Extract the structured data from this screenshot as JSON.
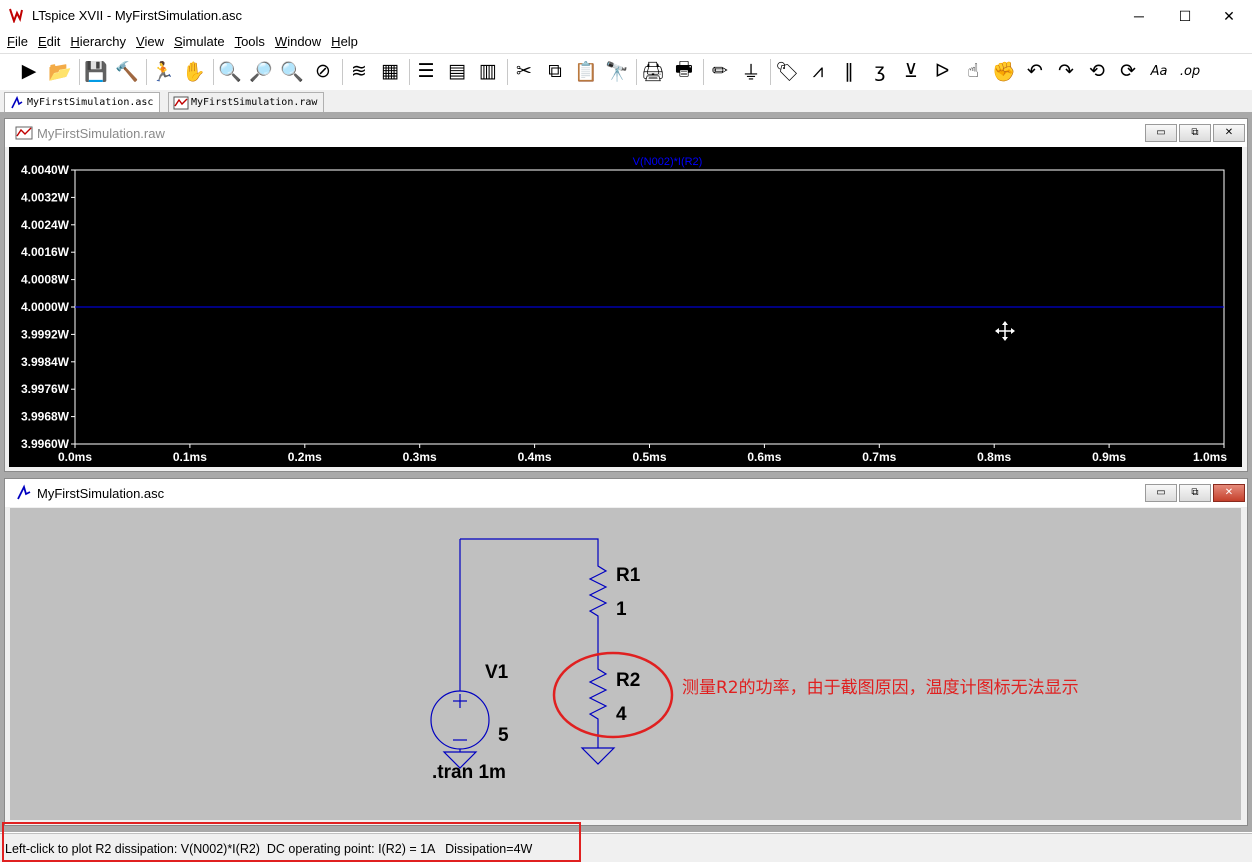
{
  "app": {
    "window_title": "LTspice XVII - MyFirstSimulation.asc",
    "controls": {
      "minimize": "─",
      "maximize": "☐",
      "close": "✕"
    }
  },
  "menu": [
    "File",
    "Edit",
    "Hierarchy",
    "View",
    "Simulate",
    "Tools",
    "Window",
    "Help"
  ],
  "menu_access_keys": [
    "F",
    "E",
    "H",
    "V",
    "S",
    "T",
    "W",
    "H"
  ],
  "toolbar": [
    {
      "name": "run-icon",
      "glyph": "▶"
    },
    {
      "name": "open-folder-icon",
      "glyph": "📂"
    },
    {
      "name": "save-icon",
      "glyph": "💾"
    },
    {
      "name": "control-panel-icon",
      "glyph": "🔨"
    },
    {
      "name": "halt-icon",
      "glyph": "🏃"
    },
    {
      "name": "pan-hand-icon",
      "glyph": "✋"
    },
    {
      "name": "zoom-in-icon",
      "glyph": "🔍"
    },
    {
      "name": "zoom-fit-icon",
      "glyph": "🔎"
    },
    {
      "name": "zoom-out-icon",
      "glyph": "🔍"
    },
    {
      "name": "zoom-cancel-icon",
      "glyph": "⊘"
    },
    {
      "name": "autorange-icon",
      "glyph": "≋"
    },
    {
      "name": "delete-trace-icon",
      "glyph": "▦"
    },
    {
      "name": "tile-horizontal-icon",
      "glyph": "☰"
    },
    {
      "name": "cascade-icon",
      "glyph": "▤"
    },
    {
      "name": "tile-vertical-icon",
      "glyph": "▥"
    },
    {
      "name": "cut-icon",
      "glyph": "✂"
    },
    {
      "name": "copy-icon",
      "glyph": "⧉"
    },
    {
      "name": "paste-icon",
      "glyph": "📋"
    },
    {
      "name": "find-icon",
      "glyph": "🔭"
    },
    {
      "name": "print-icon",
      "glyph": "🖨"
    },
    {
      "name": "print-setup-icon",
      "glyph": "🖶"
    },
    {
      "name": "draw-wire-icon",
      "glyph": "✏"
    },
    {
      "name": "ground-icon",
      "glyph": "⏚"
    },
    {
      "name": "label-net-icon",
      "glyph": "🏷"
    },
    {
      "name": "resistor-icon",
      "glyph": "⩘"
    },
    {
      "name": "capacitor-icon",
      "glyph": "‖"
    },
    {
      "name": "inductor-icon",
      "glyph": "ʒ"
    },
    {
      "name": "diode-icon",
      "glyph": "⊻"
    },
    {
      "name": "component-icon",
      "glyph": "ᐅ"
    },
    {
      "name": "move-icon",
      "glyph": "☝"
    },
    {
      "name": "drag-icon",
      "glyph": "✊"
    },
    {
      "name": "undo-icon",
      "glyph": "↶"
    },
    {
      "name": "redo-icon",
      "glyph": "↷"
    },
    {
      "name": "rotate-icon",
      "glyph": "⟲"
    },
    {
      "name": "mirror-icon",
      "glyph": "⟳"
    },
    {
      "name": "text-icon",
      "glyph": "Aa"
    },
    {
      "name": "spice-directive-icon",
      "glyph": ".op"
    }
  ],
  "tabs": [
    {
      "label": "MyFirstSimulation.asc",
      "active": true
    },
    {
      "label": "MyFirstSimulation.raw",
      "active": false
    }
  ],
  "waveform_window": {
    "title": "MyFirstSimulation.raw",
    "trace_label": "V(N002)*I(R2)",
    "trace_color": "#0000ff",
    "background": "#000000",
    "cursor_icon": "move-cursor-icon",
    "chart_data": {
      "type": "line",
      "series": [
        {
          "name": "V(N002)*I(R2)",
          "x": [
            0.0,
            1.0
          ],
          "y": [
            4.0,
            4.0
          ]
        }
      ],
      "x_unit": "ms",
      "xlim": [
        0.0,
        1.0
      ],
      "ylim": [
        3.996,
        4.004
      ],
      "xticks": [
        "0.0ms",
        "0.1ms",
        "0.2ms",
        "0.3ms",
        "0.4ms",
        "0.5ms",
        "0.6ms",
        "0.7ms",
        "0.8ms",
        "0.9ms",
        "1.0ms"
      ],
      "yticks": [
        "4.0040W",
        "4.0032W",
        "4.0024W",
        "4.0016W",
        "4.0008W",
        "4.0000W",
        "3.9992W",
        "3.9984W",
        "3.9976W",
        "3.9968W",
        "3.9960W"
      ],
      "grid": false
    }
  },
  "schematic_window": {
    "title": "MyFirstSimulation.asc",
    "components": {
      "r1": {
        "name": "R1",
        "value": "1"
      },
      "r2": {
        "name": "R2",
        "value": "4"
      },
      "v1": {
        "name": "V1",
        "value": "5"
      }
    },
    "directive": ".tran 1m",
    "annotation": "测量R2的功率，由于截图原因，温度计图标无法显示",
    "annotation_color": "#e02020",
    "wire_color": "#0000c0",
    "background": "#c0c0c0"
  },
  "status": {
    "text": "Left-click to plot R2 dissipation: V(N002)*I(R2)  DC operating point: I(R2) = 1A   Dissipation=4W"
  }
}
